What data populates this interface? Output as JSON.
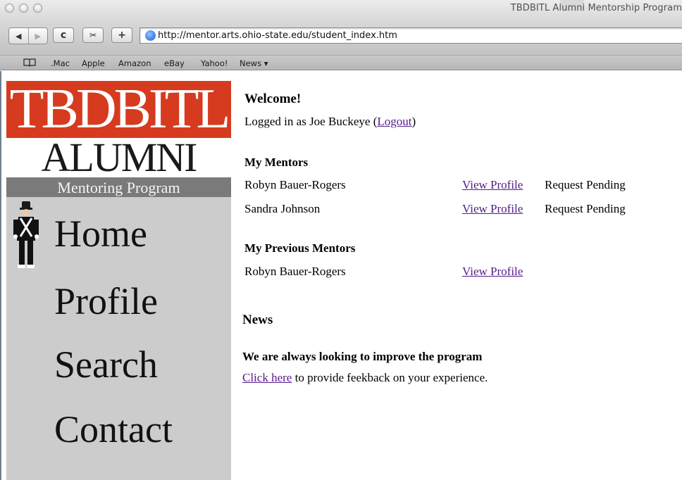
{
  "browser": {
    "window_title": "TBDBITL Alumni Mentorship Program",
    "url": "http://mentor.arts.ohio-state.edu/student_index.htm",
    "back_label": "◀",
    "forward_label": "▶",
    "reload_label": "c",
    "snip_label": "✂",
    "add_label": "+",
    "bookmarks": [
      ".Mac",
      "Apple",
      "Amazon",
      "eBay",
      "Yahoo!",
      "News ▾"
    ]
  },
  "logo": {
    "line1": "TBDBITL",
    "line2": "ALUMNI",
    "line3": "Mentoring Program"
  },
  "nav": {
    "items": [
      "Home",
      "Profile",
      "Search",
      "Contact"
    ]
  },
  "welcome": {
    "heading": "Welcome!",
    "logged_in_prefix": "Logged in as Joe Buckeye (",
    "logout_label": "Logout",
    "logged_in_suffix": ")"
  },
  "mentors": {
    "heading": "My Mentors",
    "rows": [
      {
        "name": "Robyn Bauer-Rogers",
        "link": "View Profile",
        "status": "Request Pending"
      },
      {
        "name": "Sandra Johnson",
        "link": "View Profile",
        "status": "Request Pending"
      }
    ]
  },
  "previous_mentors": {
    "heading": "My Previous Mentors",
    "rows": [
      {
        "name": "Robyn Bauer-Rogers",
        "link": "View Profile"
      }
    ]
  },
  "news": {
    "heading": "News",
    "item_title": "We are always looking to improve the program",
    "feedback_link": "Click here",
    "feedback_text": " to provide feekback on your experience."
  }
}
